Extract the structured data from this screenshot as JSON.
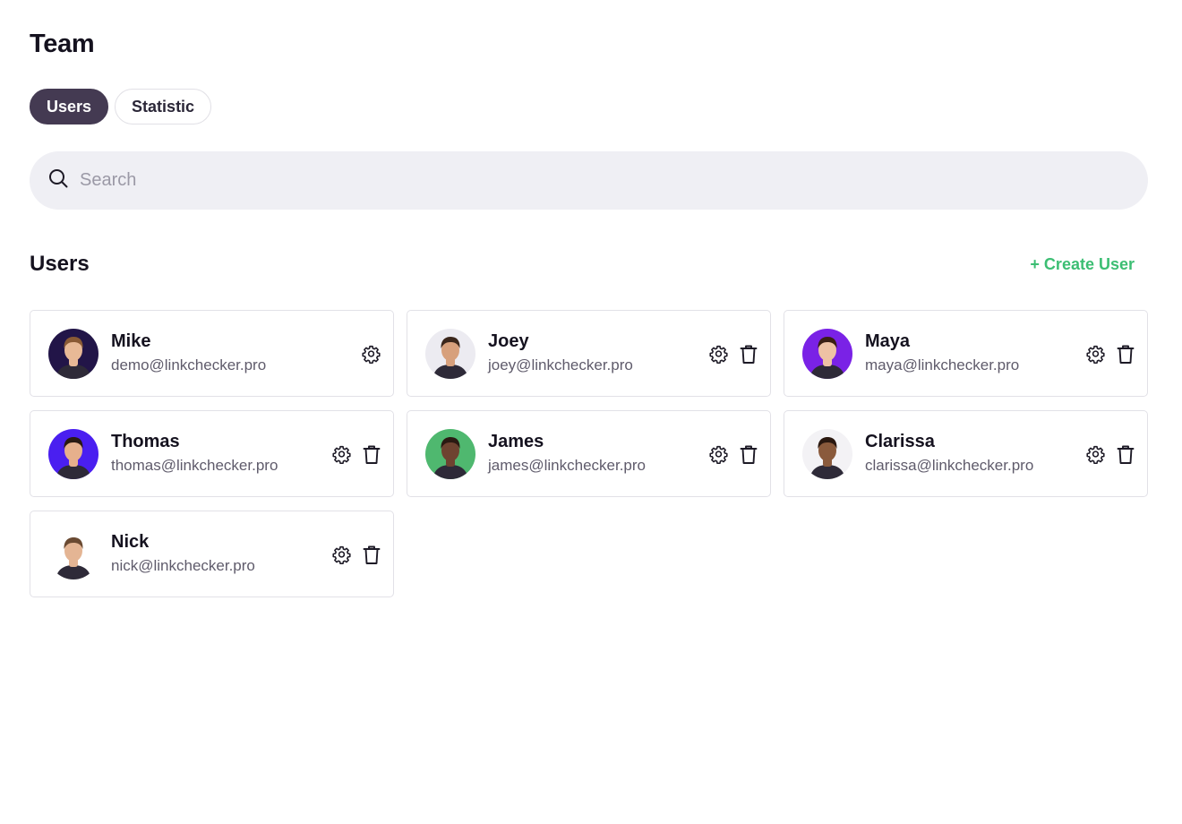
{
  "page": {
    "title": "Team"
  },
  "tabs": [
    {
      "label": "Users",
      "active": true
    },
    {
      "label": "Statistic",
      "active": false
    }
  ],
  "search": {
    "placeholder": "Search",
    "value": ""
  },
  "users_section": {
    "title": "Users",
    "create_label": "+ Create User"
  },
  "users": [
    {
      "name": "Mike",
      "email": "demo@linkchecker.pro",
      "avatar_bg": "#221548",
      "skin": "#e8b996",
      "hair": "#8a5a35",
      "can_delete": false
    },
    {
      "name": "Joey",
      "email": "joey@linkchecker.pro",
      "avatar_bg": "#ecebf1",
      "skin": "#d7a07c",
      "hair": "#3b271c",
      "can_delete": true
    },
    {
      "name": "Maya",
      "email": "maya@linkchecker.pro",
      "avatar_bg": "#7a22e6",
      "skin": "#eec2a4",
      "hair": "#3a1f14",
      "can_delete": true
    },
    {
      "name": "Thomas",
      "email": "thomas@linkchecker.pro",
      "avatar_bg": "#4a1ff0",
      "skin": "#e6b08c",
      "hair": "#2a1a12",
      "can_delete": true
    },
    {
      "name": "James",
      "email": "james@linkchecker.pro",
      "avatar_bg": "#4fb86f",
      "skin": "#6e4330",
      "hair": "#2a1a12",
      "can_delete": true
    },
    {
      "name": "Clarissa",
      "email": "clarissa@linkchecker.pro",
      "avatar_bg": "#f3f2f5",
      "skin": "#8a5a3c",
      "hair": "#2a1810",
      "can_delete": true
    },
    {
      "name": "Nick",
      "email": "nick@linkchecker.pro",
      "avatar_bg": "#ffffff",
      "skin": "#e4b594",
      "hair": "#6a4a32",
      "can_delete": true
    }
  ],
  "colors": {
    "accent_green": "#3cbe73",
    "tab_active": "#443a52",
    "search_bg": "#efeff4"
  },
  "icons": {
    "search": "search-icon",
    "settings": "gear-icon",
    "delete": "trash-icon"
  }
}
